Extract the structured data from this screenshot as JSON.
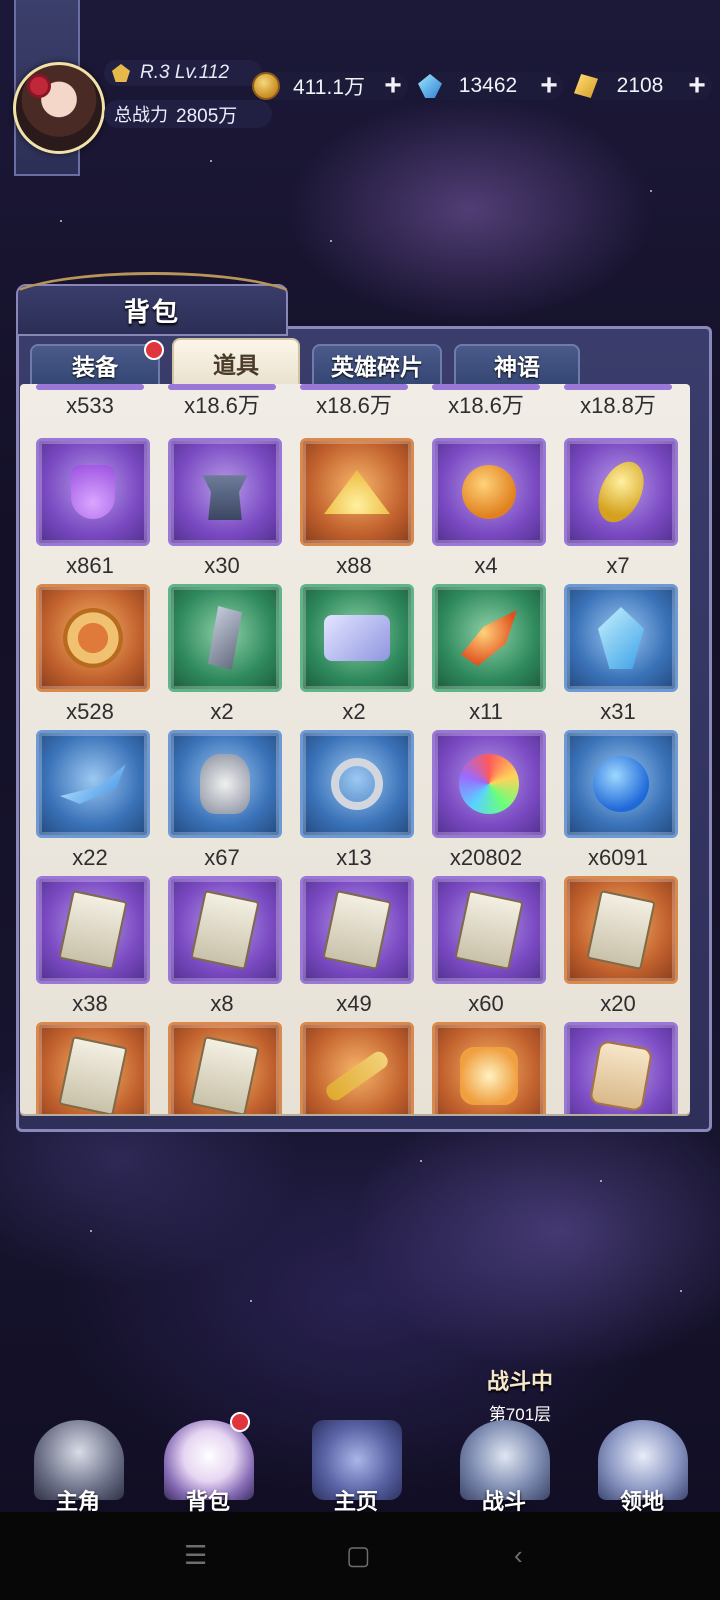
{
  "player": {
    "level_text": "R.3 Lv.112",
    "power_label": "总战力",
    "power_value": "2805万"
  },
  "resources": [
    {
      "name": "coin",
      "icon": "coin-icon",
      "value": "411.1万",
      "plus": "+"
    },
    {
      "name": "crystal",
      "icon": "crystal-icon",
      "value": "13462",
      "plus": "+"
    },
    {
      "name": "gold",
      "icon": "gold-icon",
      "value": "2108",
      "plus": "+"
    }
  ],
  "bag": {
    "title": "背包",
    "tabs": [
      {
        "label": "装备",
        "active": false
      },
      {
        "label": "道具",
        "active": true
      },
      {
        "label": "英雄碎片",
        "active": false
      },
      {
        "label": "神语",
        "active": false
      }
    ],
    "top_row_qty": [
      "x533",
      "x18.6万",
      "x18.6万",
      "x18.6万",
      "x18.8万"
    ],
    "rows": [
      [
        {
          "qty": "x861",
          "rarity": "purple",
          "icon": "purple-potion-flask-icon"
        },
        {
          "qty": "x30",
          "rarity": "purple",
          "icon": "anvil-hammer-icon"
        },
        {
          "qty": "x88",
          "rarity": "orange",
          "icon": "gold-sand-pile-icon"
        },
        {
          "qty": "x4",
          "rarity": "purple",
          "icon": "orange-potion-icon"
        },
        {
          "qty": "x7",
          "rarity": "purple",
          "icon": "golden-seed-icon"
        }
      ],
      [
        {
          "qty": "x528",
          "rarity": "orange",
          "icon": "rose-coin-icon"
        },
        {
          "qty": "x2",
          "rarity": "green",
          "icon": "steel-shard-icon"
        },
        {
          "qty": "x2",
          "rarity": "green",
          "icon": "scroll-icon"
        },
        {
          "qty": "x11",
          "rarity": "green",
          "icon": "fire-leaf-icon"
        },
        {
          "qty": "x31",
          "rarity": "blue",
          "icon": "blue-crystal-icon"
        }
      ],
      [
        {
          "qty": "x22",
          "rarity": "blue",
          "icon": "ice-crescent-icon"
        },
        {
          "qty": "x67",
          "rarity": "blue",
          "icon": "skull-mask-icon"
        },
        {
          "qty": "x13",
          "rarity": "blue",
          "icon": "shackle-icon"
        },
        {
          "qty": "x20802",
          "rarity": "purple",
          "icon": "rainbow-orb-icon"
        },
        {
          "qty": "x6091",
          "rarity": "blue",
          "icon": "blue-potion-icon"
        }
      ],
      [
        {
          "qty": "x38",
          "rarity": "purple",
          "icon": "hero-card-icon"
        },
        {
          "qty": "x8",
          "rarity": "purple",
          "icon": "hero-card-icon"
        },
        {
          "qty": "x49",
          "rarity": "purple",
          "icon": "hero-card-icon"
        },
        {
          "qty": "x60",
          "rarity": "purple",
          "icon": "hero-card-icon"
        },
        {
          "qty": "x20",
          "rarity": "orange",
          "icon": "hero-card-icon"
        }
      ],
      [
        {
          "qty": "",
          "rarity": "orange",
          "icon": "hero-card-icon"
        },
        {
          "qty": "",
          "rarity": "orange",
          "icon": "hero-card-icon"
        },
        {
          "qty": "",
          "rarity": "orange",
          "icon": "ruby-key-icon"
        },
        {
          "qty": "",
          "rarity": "orange",
          "icon": "glowing-puzzle-icon"
        },
        {
          "qty": "",
          "rarity": "purple",
          "icon": "tag-charm-icon"
        }
      ]
    ]
  },
  "battle_status": {
    "line1": "战斗中",
    "line2": "第701层"
  },
  "nav": [
    {
      "label": "主角",
      "icon": "hero-hood-icon"
    },
    {
      "label": "背包",
      "icon": "bag-icon"
    },
    {
      "label": "主页",
      "icon": "book-icon"
    },
    {
      "label": "战斗",
      "icon": "crossed-swords-icon"
    },
    {
      "label": "领地",
      "icon": "castle-icon"
    }
  ],
  "colors": {
    "purple": "#7a4ac2",
    "orange": "#c2622e",
    "green": "#2f8a5d",
    "blue": "#3a72b8",
    "badge_red": "#e0343e"
  }
}
